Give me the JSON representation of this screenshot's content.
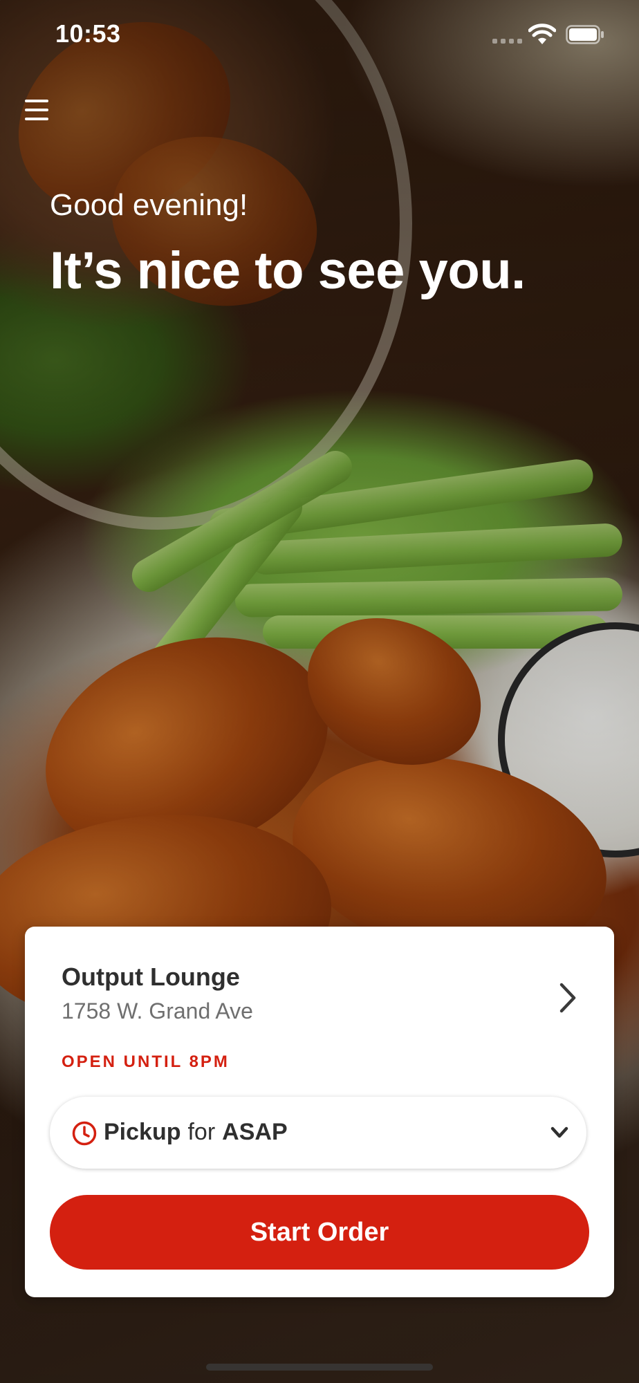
{
  "status_bar": {
    "time": "10:53"
  },
  "header": {
    "menu_icon": "hamburger-menu-icon",
    "greeting": "Good evening!",
    "headline": "It’s nice to see you."
  },
  "location_card": {
    "name": "Output Lounge",
    "address": "1758 W. Grand Ave",
    "hours_status": "OPEN UNTIL 8PM",
    "order_type": {
      "mode": "Pickup",
      "connector": "for",
      "time": "ASAP"
    },
    "start_order_label": "Start Order"
  },
  "colors": {
    "accent": "#D42010",
    "card_background": "#FFFFFF",
    "primary_text": "#2F2F2F",
    "secondary_text": "#6F6F6F"
  },
  "icons": {
    "location_chevron": "chevron-right-icon",
    "order_time": "clock-icon",
    "order_dropdown": "chevron-down-icon"
  }
}
